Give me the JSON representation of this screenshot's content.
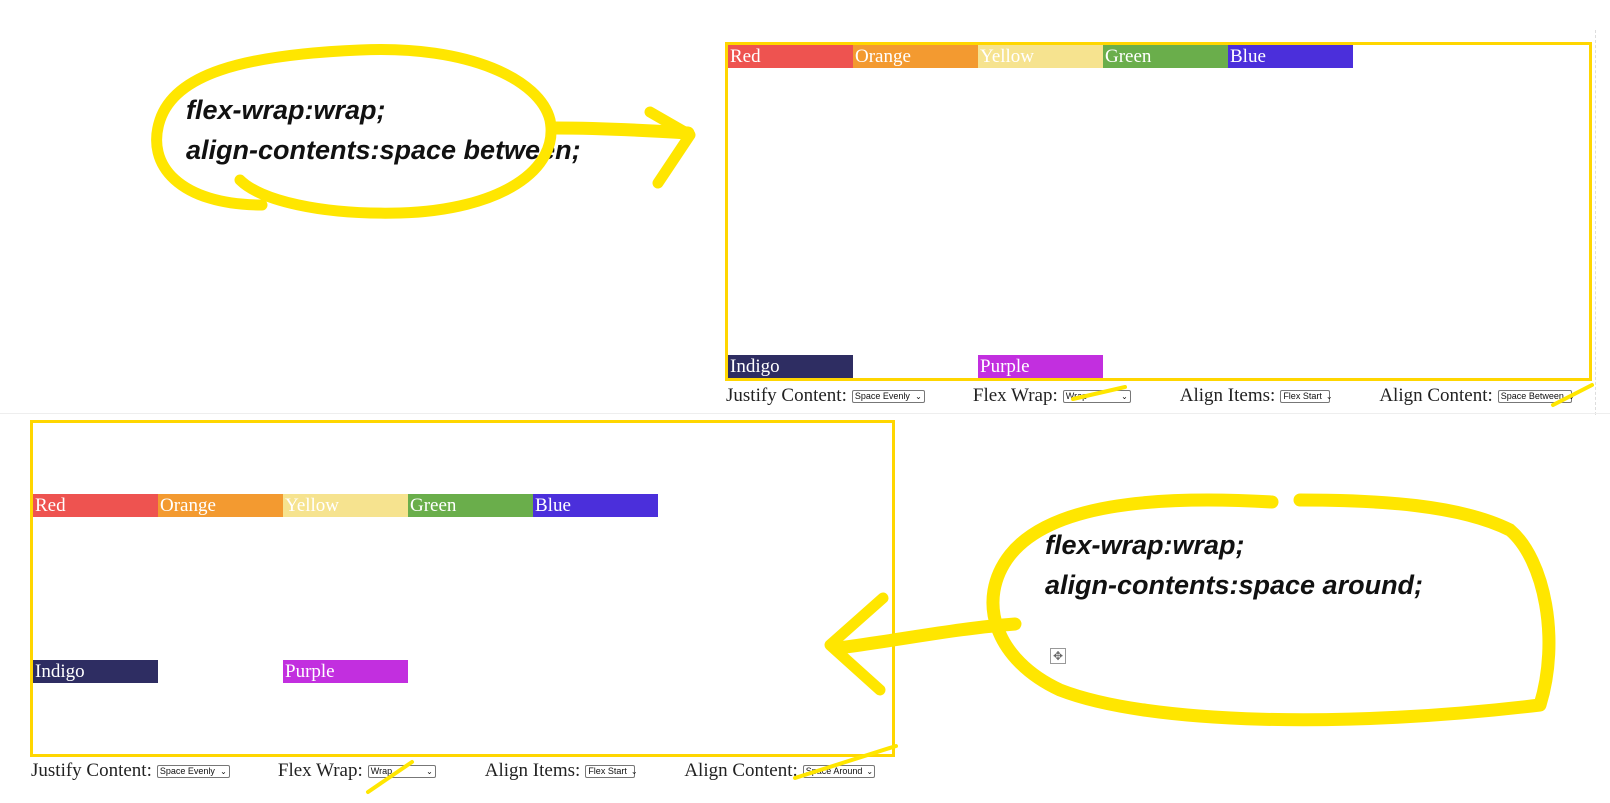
{
  "annotations": {
    "top": {
      "line1": "flex-wrap:wrap;",
      "line2": "align-contents:space between;"
    },
    "bottom": {
      "line1": "flex-wrap:wrap;",
      "line2": "align-contents:space around;"
    }
  },
  "items": [
    {
      "label": "Red",
      "color": "#ee5350"
    },
    {
      "label": "Orange",
      "color": "#f39a30"
    },
    {
      "label": "Yellow",
      "color": "#f6e38f"
    },
    {
      "label": "Green",
      "color": "#6aae4b"
    },
    {
      "label": "Blue",
      "color": "#4b2fdb"
    },
    {
      "label": "Indigo",
      "color": "#2e2d62"
    },
    {
      "label": "Purple",
      "color": "#c22fdf"
    }
  ],
  "top_demo": {
    "controls": {
      "justify_label": "Justify Content:",
      "justify_value": "Space Evenly",
      "wrap_label": "Flex Wrap:",
      "wrap_value": "Wrap",
      "align_items_label": "Align Items:",
      "align_items_value": "Flex Start",
      "align_content_label": "Align Content:",
      "align_content_value": "Space Between"
    }
  },
  "bottom_demo": {
    "controls": {
      "justify_label": "Justify Content:",
      "justify_value": "Space Evenly",
      "wrap_label": "Flex Wrap:",
      "wrap_value": "Wrap",
      "align_items_label": "Align Items:",
      "align_items_value": "Flex Start",
      "align_content_label": "Align Content:",
      "align_content_value": "Space Around"
    }
  },
  "colors": {
    "highlight": "#ffe600",
    "border": "#ffd600"
  }
}
